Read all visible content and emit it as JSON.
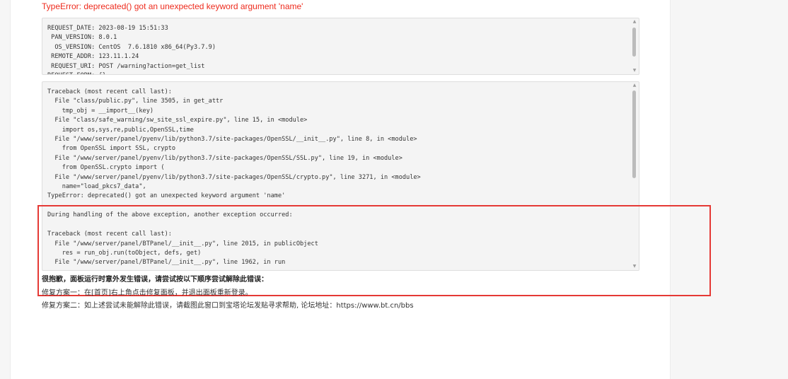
{
  "error": {
    "title": "TypeError: deprecated() got an unexpected keyword argument 'name'"
  },
  "request_info": {
    "lines": [
      "REQUEST_DATE: 2023-08-19 15:51:33",
      " PAN_VERSION: 8.0.1",
      "  OS_VERSION: CentOS  7.6.1810 x86_64(Py3.7.9)",
      " REMOTE_ADDR: 123.11.1.24",
      " REQUEST_URI: POST /warning?action=get_list",
      "REQUEST_FORM: {}"
    ]
  },
  "traceback": {
    "lines": [
      "Traceback (most recent call last):",
      "  File \"class/public.py\", line 3505, in get_attr",
      "    tmp_obj = __import__(key)",
      "  File \"class/safe_warning/sw_site_ssl_expire.py\", line 15, in <module>",
      "    import os,sys,re,public,OpenSSL,time",
      "  File \"/www/server/panel/pyenv/lib/python3.7/site-packages/OpenSSL/__init__.py\", line 8, in <module>",
      "    from OpenSSL import SSL, crypto",
      "  File \"/www/server/panel/pyenv/lib/python3.7/site-packages/OpenSSL/SSL.py\", line 19, in <module>",
      "    from OpenSSL.crypto import (",
      "  File \"/www/server/panel/pyenv/lib/python3.7/site-packages/OpenSSL/crypto.py\", line 3271, in <module>",
      "    name=\"load_pkcs7_data\",",
      "TypeError: deprecated() got an unexpected keyword argument 'name'",
      "",
      "During handling of the above exception, another exception occurred:",
      "",
      "Traceback (most recent call last):",
      "  File \"/www/server/panel/BTPanel/__init__.py\", line 2015, in publicObject",
      "    res = run_obj.run(toObject, defs, get)",
      "  File \"/www/server/panel/BTPanel/__init__.py\", line 1962, in run",
      "    ..."
    ]
  },
  "hints": {
    "apology": "很抱歉，面板运行时意外发生错误，请尝试按以下顺序尝试解除此错误：",
    "fix1": "修复方案一：在[首页]右上角点击修复面板，并退出面板重新登录。",
    "fix2": "修复方案二：如上述尝试未能解除此错误，请截图此窗口到宝塔论坛发贴寻求帮助, 论坛地址：https://www.bt.cn/bbs"
  },
  "icons": {
    "scroll_up": "triangle-up-icon",
    "scroll_down": "triangle-down-icon"
  },
  "colors": {
    "error_red": "#ee2b1d",
    "highlight_red": "#e53935"
  }
}
